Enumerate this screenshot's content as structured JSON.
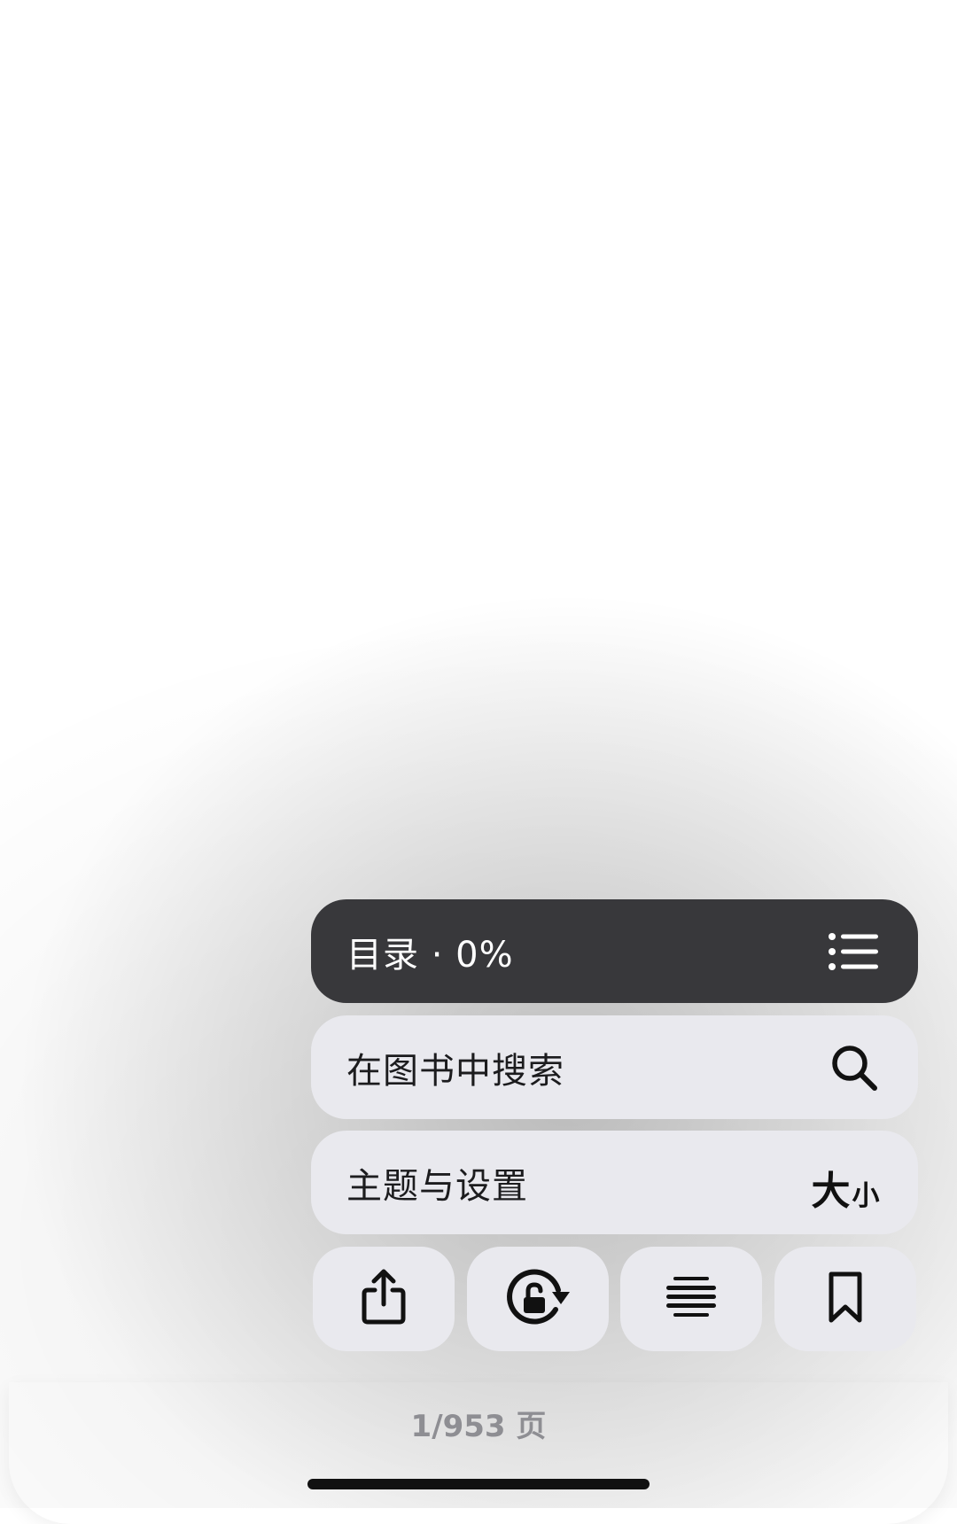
{
  "menu": {
    "toc": {
      "label": "目录 · 0%",
      "icon": "list-icon"
    },
    "search": {
      "label": "在图书中搜索",
      "icon": "search-icon"
    },
    "theme": {
      "label": "主题与设置",
      "icon_big": "大",
      "icon_small": "小"
    }
  },
  "actions": [
    {
      "name": "share",
      "icon": "share-icon"
    },
    {
      "name": "rotation-lock",
      "icon": "rotation-lock-icon"
    },
    {
      "name": "scrolling-view",
      "icon": "scroll-view-icon"
    },
    {
      "name": "bookmark",
      "icon": "bookmark-icon"
    }
  ],
  "page_indicator": {
    "text": "1/953 页"
  }
}
